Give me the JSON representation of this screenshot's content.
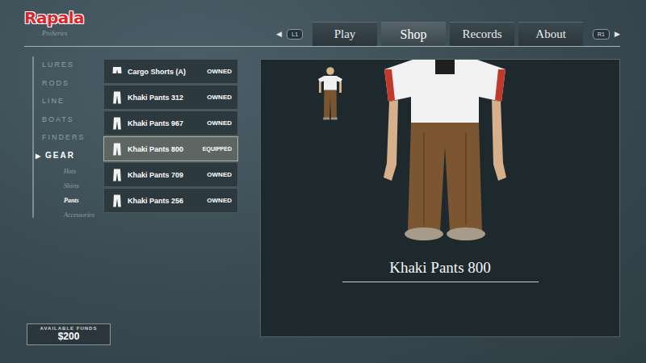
{
  "logo": {
    "brand": "Rapala",
    "sub": "ProSeries"
  },
  "nav": {
    "prev_arrow": "◀",
    "prev_button": "L1",
    "next_button": "R1",
    "next_arrow": "▶",
    "tabs": [
      {
        "label": "Play",
        "selected": false
      },
      {
        "label": "Shop",
        "selected": true
      },
      {
        "label": "Records",
        "selected": false
      },
      {
        "label": "About",
        "selected": false
      }
    ]
  },
  "sidebar": {
    "marker": "▶",
    "categories": [
      {
        "label": "LURES",
        "selected": false
      },
      {
        "label": "RODS",
        "selected": false
      },
      {
        "label": "LINE",
        "selected": false
      },
      {
        "label": "BOATS",
        "selected": false
      },
      {
        "label": "FINDERS",
        "selected": false
      },
      {
        "label": "GEAR",
        "selected": true
      }
    ],
    "subcategories": [
      {
        "label": "Hats",
        "selected": false
      },
      {
        "label": "Shirts",
        "selected": false
      },
      {
        "label": "Pants",
        "selected": true
      },
      {
        "label": "Accessories",
        "selected": false
      }
    ]
  },
  "items": [
    {
      "name": "Cargo Shorts (A)",
      "status": "OWNED",
      "kind": "shorts",
      "selected": false
    },
    {
      "name": "Khaki Pants 312",
      "status": "OWNED",
      "kind": "pants",
      "selected": false
    },
    {
      "name": "Khaki Pants 967",
      "status": "OWNED",
      "kind": "pants",
      "selected": false
    },
    {
      "name": "Khaki Pants 800",
      "status": "EQUIPPED",
      "kind": "pants",
      "selected": true
    },
    {
      "name": "Khaki Pants 709",
      "status": "OWNED",
      "kind": "pants",
      "selected": false
    },
    {
      "name": "Khaki Pants 256",
      "status": "OWNED",
      "kind": "pants",
      "selected": false
    }
  ],
  "preview": {
    "title": "Khaki Pants 800"
  },
  "funds": {
    "label": "AVAILABLE FUNDS",
    "amount": "$200"
  }
}
